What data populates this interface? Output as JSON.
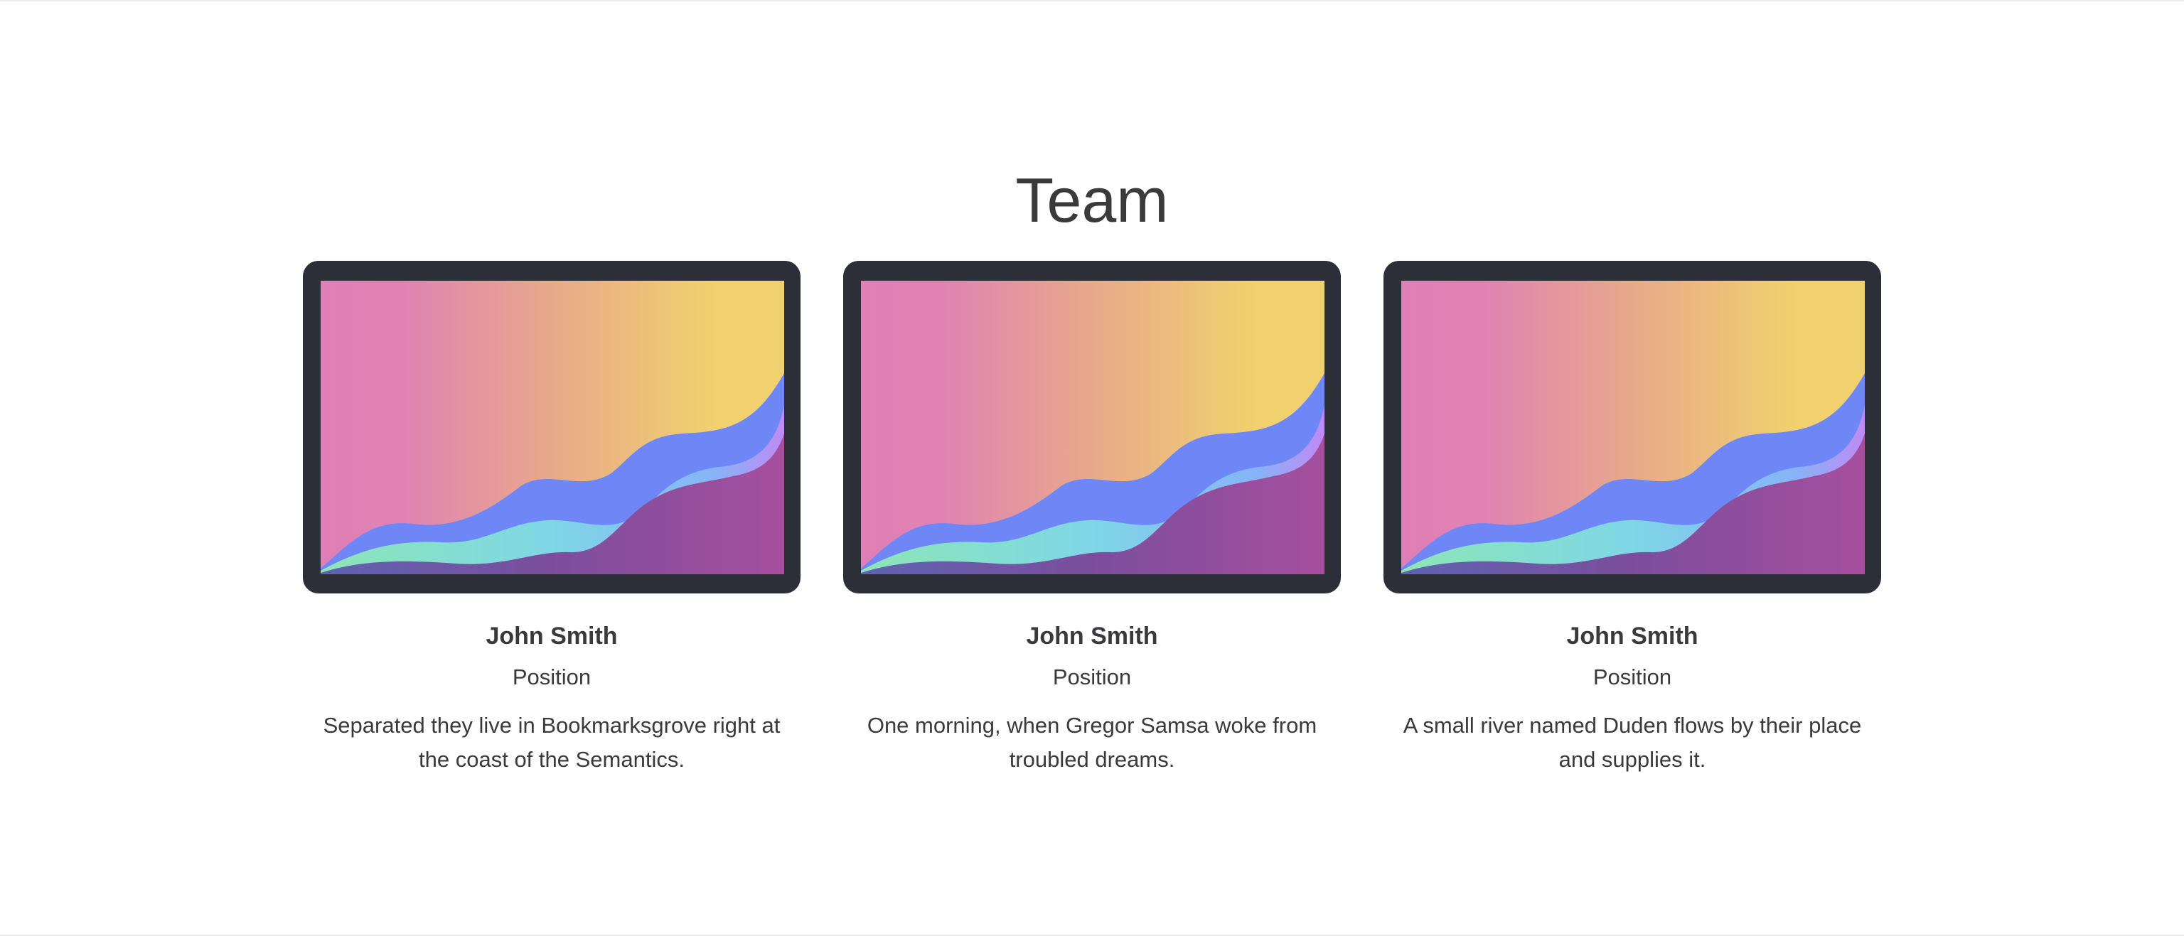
{
  "section": {
    "title": "Team"
  },
  "members": [
    {
      "name": "John Smith",
      "position": "Position",
      "bio": "Separated they live in Bookmarksgrove right at the coast of the Semantics."
    },
    {
      "name": "John Smith",
      "position": "Position",
      "bio": "One morning, when Gregor Samsa woke from troubled dreams."
    },
    {
      "name": "John Smith",
      "position": "Position",
      "bio": "A small river named Duden flows by their place and supplies it."
    }
  ],
  "colors": {
    "frame": "#2c2e38",
    "text": "#3a3a3d",
    "gradient_pink": "#df7fb6",
    "gradient_orange": "#e8a98a",
    "gradient_yellow": "#f0d16d",
    "wave_blue": "#6f86f7",
    "wave_cyan": "#7fd6e6",
    "wave_green": "#8de6b6",
    "wave_purple": "#7d4aa0",
    "wave_magenta": "#a54f9e"
  }
}
